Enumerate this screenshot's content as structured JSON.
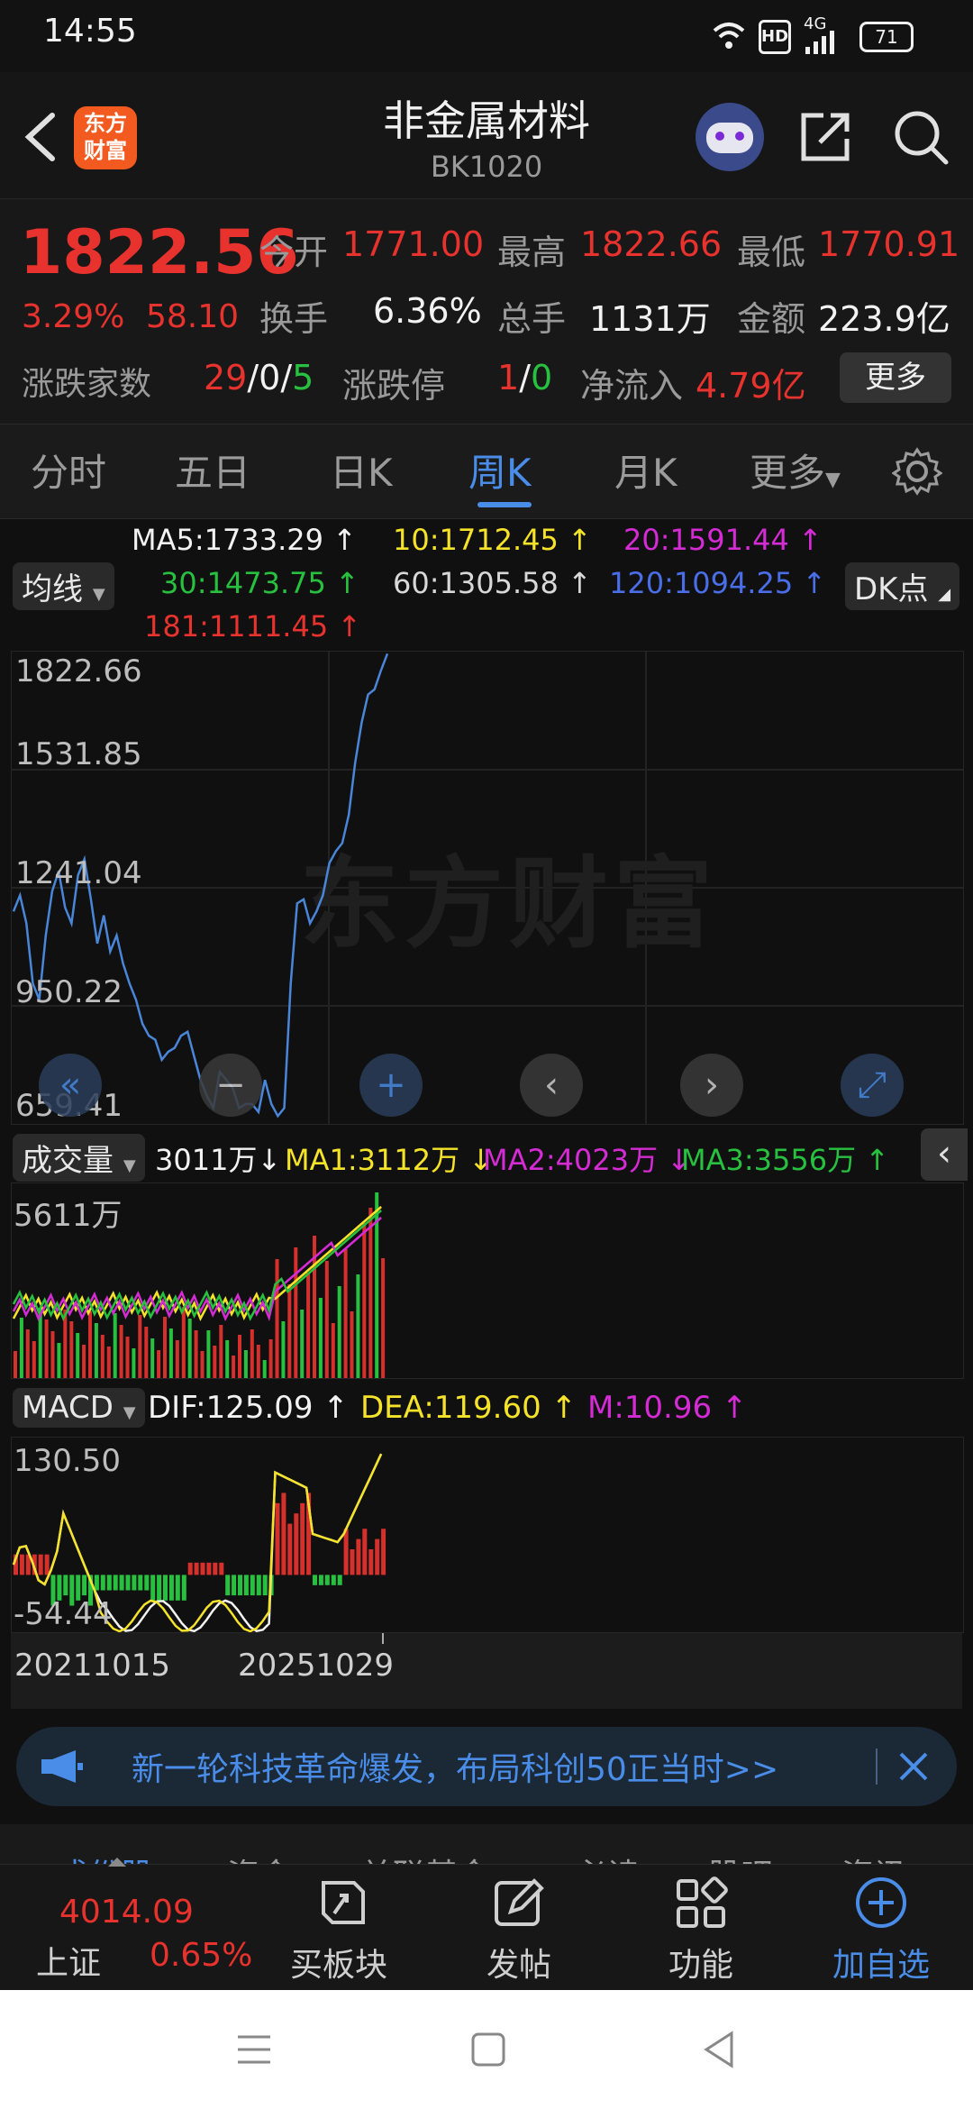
{
  "status_bar": {
    "time": "14:55",
    "battery": "71",
    "network": "4G"
  },
  "header": {
    "logo_text": "东方财富",
    "title": "非金属材料",
    "code": "BK1020"
  },
  "quote": {
    "price": "1822.56",
    "change_pct": "3.29%",
    "change_abs": "58.10",
    "open_label": "今开",
    "open_value": "1771.00",
    "high_label": "最高",
    "high_value": "1822.66",
    "low_label": "最低",
    "low_value": "1770.91",
    "turnover_label": "换手",
    "turnover_value": "6.36%",
    "volume_label": "总手",
    "volume_value": "1131万",
    "amount_label": "金额",
    "amount_value": "223.9亿",
    "updown_label": "涨跌家数",
    "up_count": "29",
    "flat_count": "0",
    "down_count": "5",
    "sep": "/",
    "limit_label": "涨跌停",
    "limit_up": "1",
    "limit_down": "0",
    "netflow_label": "净流入",
    "netflow_value": "4.79亿",
    "more_button": "更多"
  },
  "period_tabs": [
    "分时",
    "五日",
    "日K",
    "周K",
    "月K",
    "更多"
  ],
  "active_tab": "周K",
  "ma_legend": {
    "chip": "均线",
    "dk_button": "DK点",
    "ma5": "MA5:1733.29",
    "ma10": "10:1712.45",
    "ma20": "20:1591.44",
    "ma30": "30:1473.75",
    "ma60": "60:1305.58",
    "ma120": "120:1094.25",
    "ma181": "181:1111.45",
    "arrow_up": "↑",
    "colors": {
      "ma5": "#f2f2f2",
      "ma10": "#f5e32a",
      "ma20": "#d52bd5",
      "ma30": "#27c13f",
      "ma60": "#d8d8d8",
      "ma120": "#4a6de8",
      "ma181": "#e8322e"
    }
  },
  "price_axis": [
    "1822.66",
    "1531.85",
    "1241.04",
    "950.22",
    "659.41"
  ],
  "watermark": "东方财富",
  "volume_legend": {
    "chip": "成交量",
    "vol": "3011万",
    "ma1": "MA1:3112万",
    "ma2": "MA2:4023万",
    "ma3": "MA3:3556万",
    "arrow_down": "↓",
    "arrow_up": "↑",
    "axis_top": "5611万"
  },
  "macd_legend": {
    "chip": "MACD",
    "dif": "DIF:125.09",
    "dea": "DEA:119.60",
    "m": "M:10.96",
    "arrow_up": "↑",
    "axis_top": "130.50",
    "axis_bottom": "-54.44"
  },
  "dates": {
    "start": "20211015",
    "end": "20251029"
  },
  "banner": {
    "text": "新一轮科技革命爆发，布局科创50正当时>>"
  },
  "section_tabs": [
    "成份股",
    "资金",
    "关联基金",
    "必读",
    "股吧",
    "资讯"
  ],
  "bottom_bar": {
    "index_value": "4014.09",
    "index_name": "上证",
    "index_change": "0.65%",
    "items": [
      "买板块",
      "发帖",
      "功能",
      "加自选"
    ]
  },
  "chart_data": {
    "type": "line",
    "title": "",
    "ylim": [
      659.41,
      1822.66
    ],
    "x_range": [
      "20211015",
      "20251029"
    ],
    "series": [
      {
        "values": [
          1180,
          1220,
          1150,
          1000,
          960,
          1120,
          1230,
          1280,
          1190,
          1150,
          1270,
          1310,
          1210,
          1100,
          1170,
          1080,
          1120,
          1050,
          1000,
          960,
          900,
          870,
          860,
          810,
          830,
          840,
          870,
          880,
          820,
          760,
          720,
          690,
          780,
          760,
          740,
          690,
          700,
          700,
          680,
          760,
          700,
          670,
          690,
          1000,
          1200,
          1210,
          1150,
          1180,
          1220,
          1300,
          1330,
          1350,
          1420,
          1550,
          1650,
          1720,
          1733,
          1780,
          1822
        ]
      }
    ],
    "volume": {
      "axis_top": "5611万",
      "latest": "3011万"
    },
    "macd": {
      "ylim": [
        -54.44,
        130.5
      ],
      "dif": 125.09,
      "dea": 119.6,
      "m": 10.96
    }
  }
}
